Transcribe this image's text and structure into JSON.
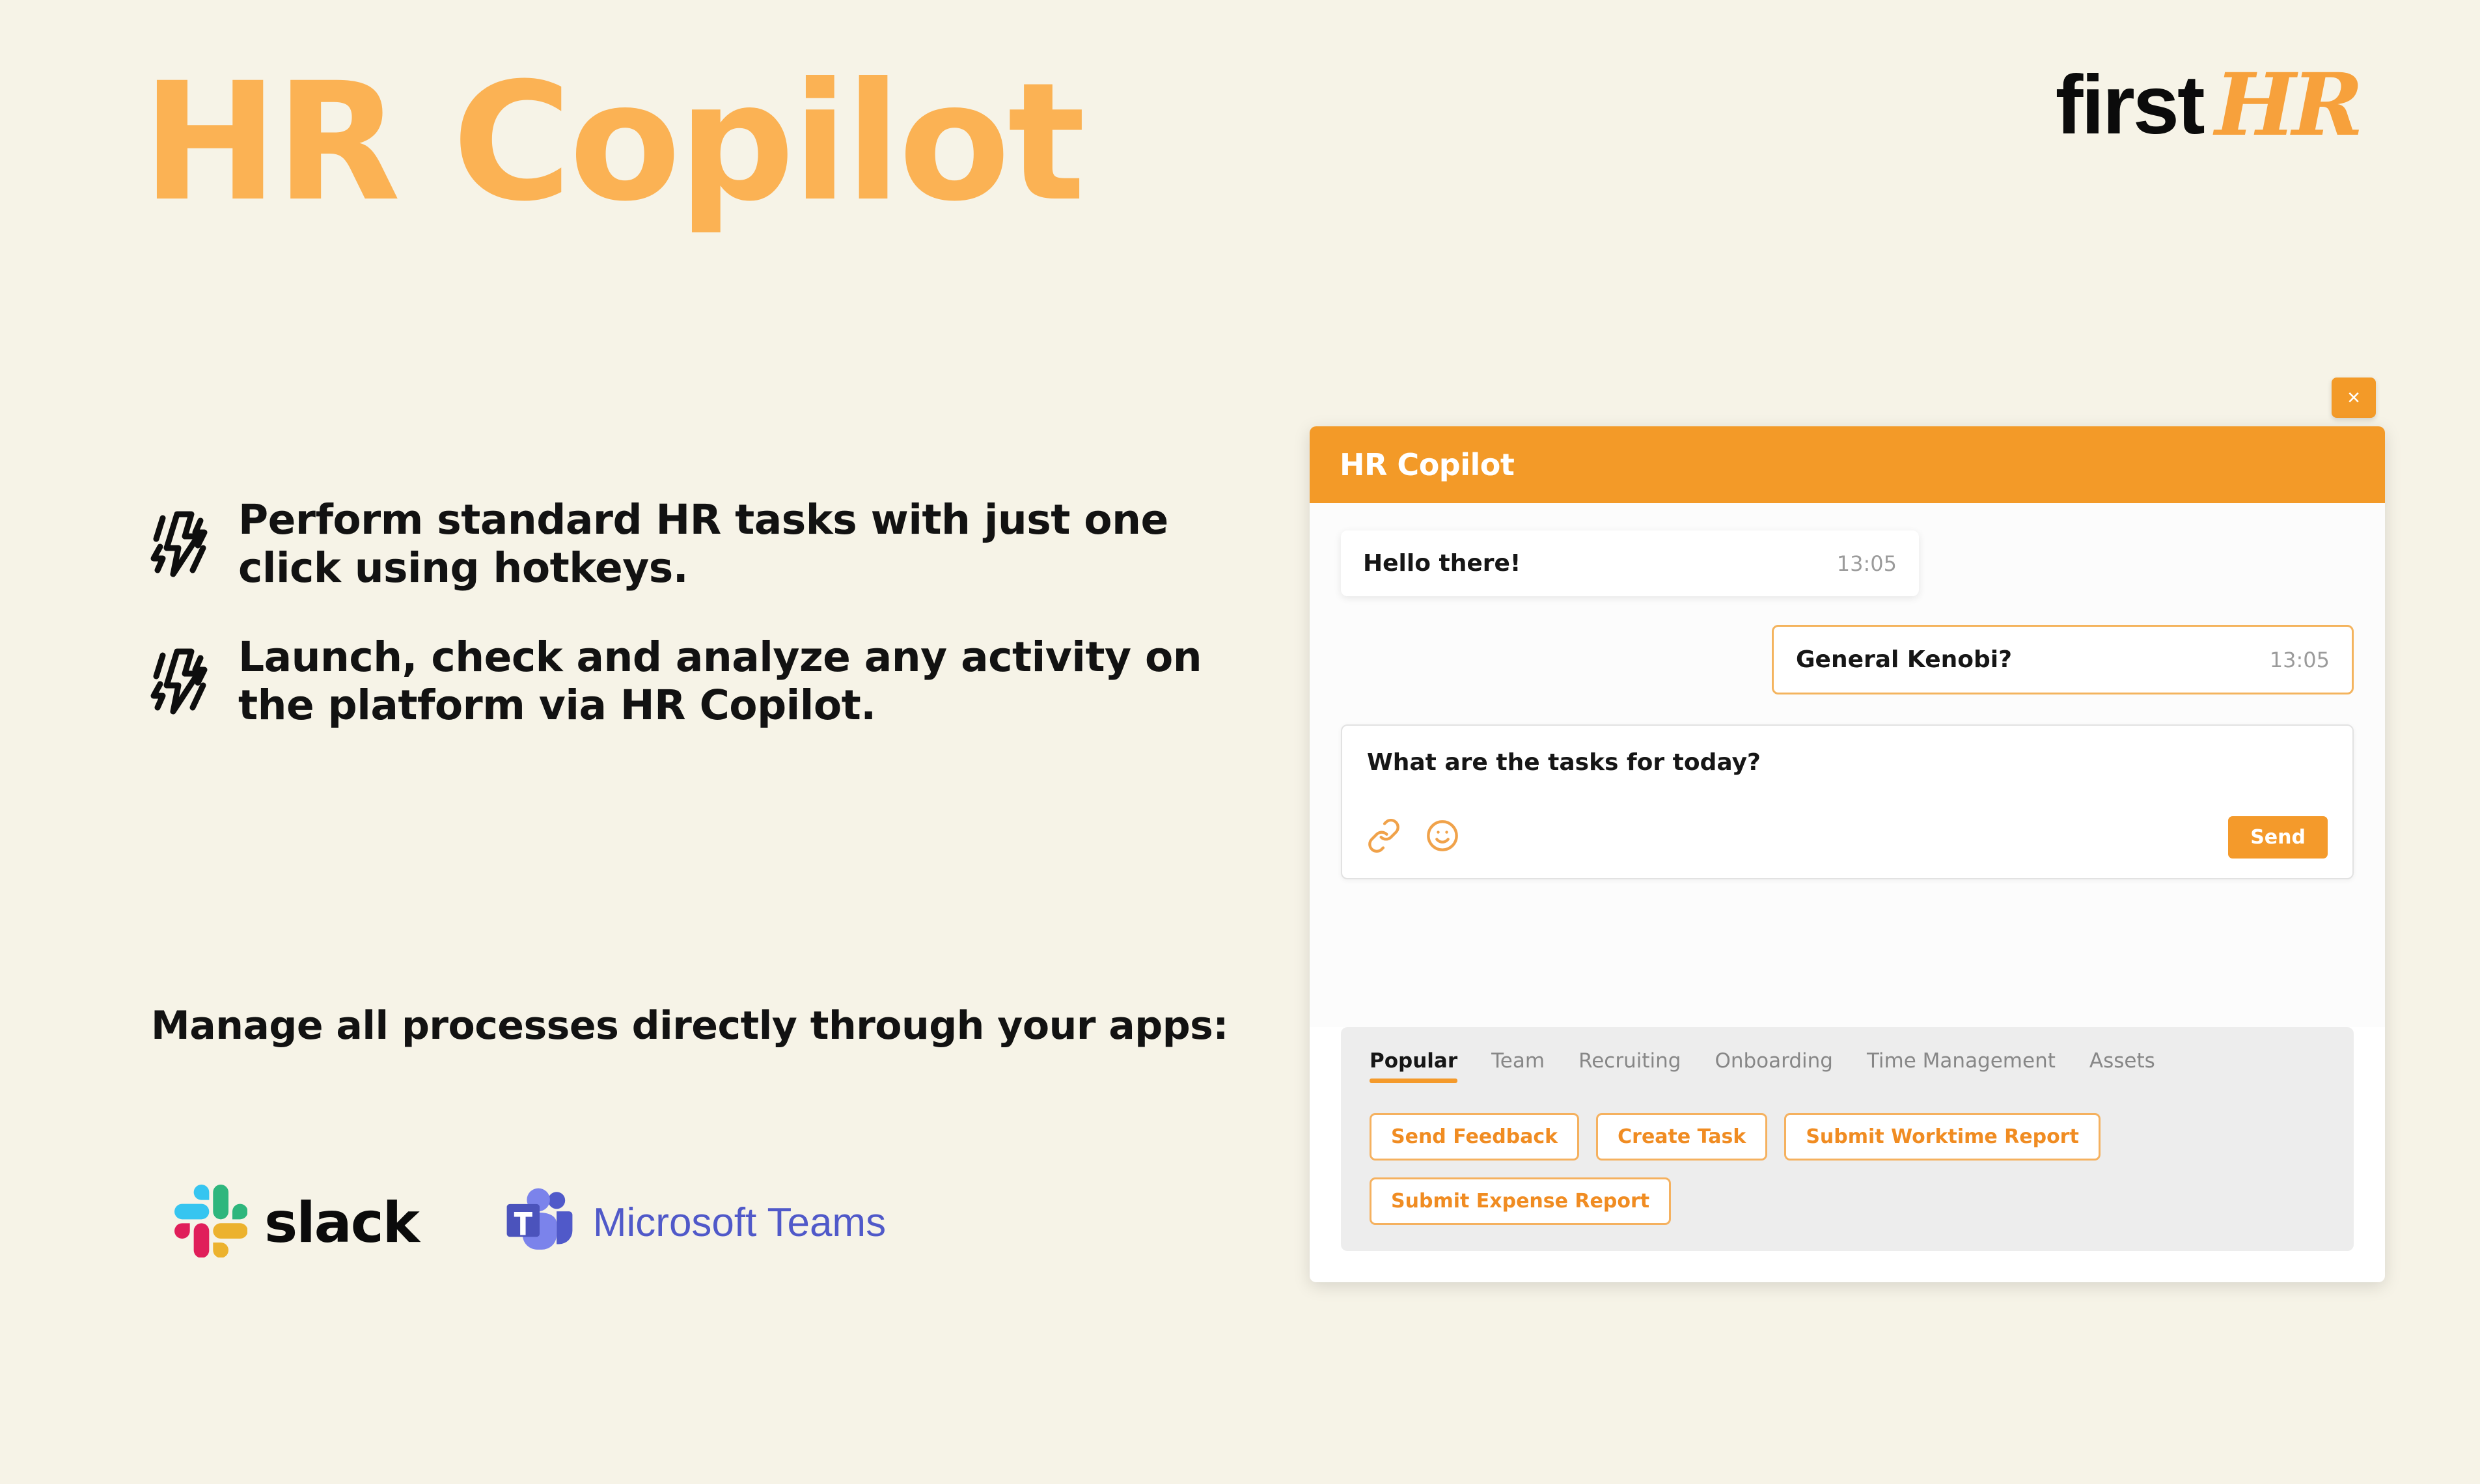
{
  "brand": {
    "first": "first",
    "hr": "HR"
  },
  "page_title": "HR Copilot",
  "bullets": [
    {
      "icon": "lightning-bolt-icon",
      "text": "Perform standard HR tasks with just one click using hotkeys."
    },
    {
      "icon": "lightning-bolt-icon",
      "text": "Launch, check and analyze any activity on the platform via HR Copilot."
    }
  ],
  "apps_section": {
    "heading": "Manage all processes directly through your apps:",
    "apps": [
      {
        "name": "slack",
        "label": "slack"
      },
      {
        "name": "microsoft-teams",
        "label": "Microsoft Teams"
      }
    ]
  },
  "widget": {
    "header_title": "HR Copilot",
    "close_label": "×",
    "messages": [
      {
        "text": "Hello there!",
        "time": "13:05",
        "direction": "incoming"
      },
      {
        "text": "General Kenobi?",
        "time": "13:05",
        "direction": "outgoing"
      }
    ],
    "composer": {
      "value": "What are the tasks for today?",
      "placeholder": "What are the tasks for today?",
      "attach_icon": "paperclip-icon",
      "emoji_icon": "smiley-icon",
      "send_label": "Send"
    },
    "tabs": [
      {
        "label": "Popular",
        "active": true
      },
      {
        "label": "Team",
        "active": false
      },
      {
        "label": "Recruiting",
        "active": false
      },
      {
        "label": "Onboarding",
        "active": false
      },
      {
        "label": "Time Management",
        "active": false
      },
      {
        "label": "Assets",
        "active": false
      }
    ],
    "quick_actions": [
      "Send Feedback",
      "Create Task",
      "Submit  Worktime Report",
      "Submit Expense Report"
    ]
  },
  "colors": {
    "background": "#F6F3E7",
    "title_orange": "#FBB254",
    "brand_orange": "#F7A13C",
    "header_orange": "#F39A28",
    "accent_orange": "#F49A2B",
    "text_dark": "#121212",
    "panel_gray": "#EDEDED",
    "teams_purple": "#5059C9"
  }
}
